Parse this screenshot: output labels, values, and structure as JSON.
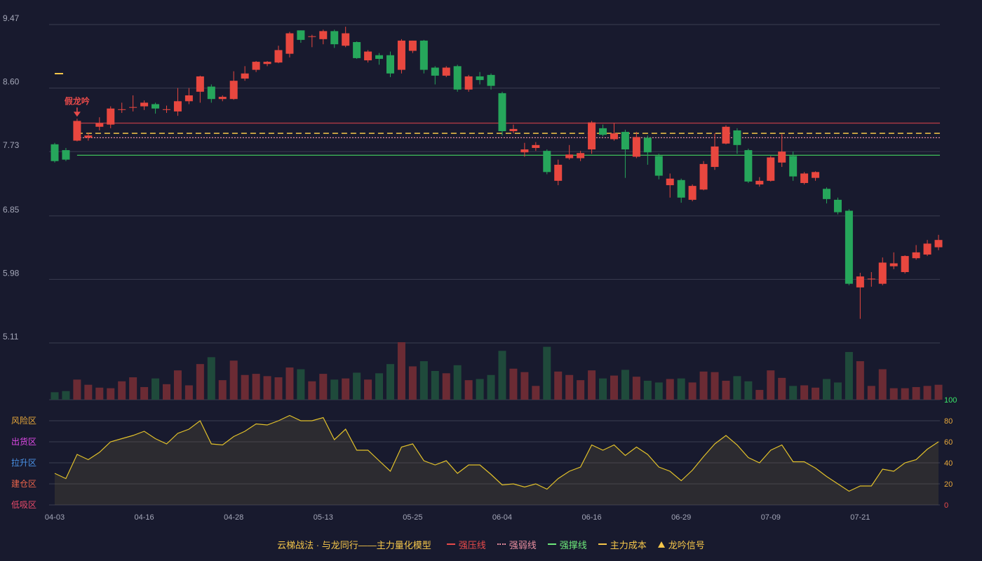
{
  "chart_data": {
    "type": "candlestick",
    "price_ticks": [
      "9.47",
      "8.60",
      "7.73",
      "6.85",
      "5.98",
      "5.11"
    ],
    "ylim": [
      5.11,
      9.47
    ],
    "x_ticks": [
      "04-03",
      "04-16",
      "04-28",
      "05-13",
      "05-25",
      "06-04",
      "06-16",
      "06-29",
      "07-09",
      "07-21"
    ],
    "x_tick_index": [
      0,
      8,
      16,
      24,
      32,
      40,
      48,
      56,
      64,
      72
    ],
    "candles": [
      [
        7.83,
        7.6,
        7.85,
        7.58
      ],
      [
        7.75,
        7.62,
        7.78,
        7.6
      ],
      [
        7.88,
        8.15,
        8.18,
        7.87
      ],
      [
        7.92,
        7.95,
        7.99,
        7.88
      ],
      [
        8.07,
        8.12,
        8.2,
        8.02
      ],
      [
        8.1,
        8.32,
        8.35,
        8.05
      ],
      [
        8.3,
        8.31,
        8.4,
        8.26
      ],
      [
        8.33,
        8.34,
        8.5,
        8.28
      ],
      [
        8.35,
        8.4,
        8.43,
        8.3
      ],
      [
        8.38,
        8.32,
        8.4,
        8.25
      ],
      [
        8.3,
        8.31,
        8.36,
        8.26
      ],
      [
        8.28,
        8.42,
        8.6,
        8.22
      ],
      [
        8.42,
        8.5,
        8.6,
        8.38
      ],
      [
        8.55,
        8.76,
        8.77,
        8.4
      ],
      [
        8.62,
        8.45,
        8.65,
        8.4
      ],
      [
        8.45,
        8.48,
        8.5,
        8.42
      ],
      [
        8.45,
        8.7,
        8.83,
        8.44
      ],
      [
        8.73,
        8.8,
        8.9,
        8.7
      ],
      [
        8.85,
        8.96,
        8.97,
        8.82
      ],
      [
        8.93,
        8.96,
        8.97,
        8.9
      ],
      [
        8.95,
        9.12,
        9.18,
        8.94
      ],
      [
        9.07,
        9.35,
        9.37,
        9.02
      ],
      [
        9.39,
        9.26,
        9.39,
        9.22
      ],
      [
        9.3,
        9.31,
        9.33,
        9.16
      ],
      [
        9.27,
        9.38,
        9.4,
        9.2
      ],
      [
        9.38,
        9.2,
        9.4,
        9.15
      ],
      [
        9.18,
        9.35,
        9.44,
        9.16
      ],
      [
        9.23,
        9.01,
        9.24,
        9.0
      ],
      [
        8.98,
        9.1,
        9.12,
        8.95
      ],
      [
        9.05,
        9.0,
        9.08,
        8.92
      ],
      [
        9.05,
        8.8,
        9.1,
        8.75
      ],
      [
        8.85,
        9.25,
        9.27,
        8.8
      ],
      [
        9.11,
        9.25,
        9.25,
        9.08
      ],
      [
        9.25,
        8.85,
        9.26,
        8.8
      ],
      [
        8.88,
        8.77,
        8.9,
        8.65
      ],
      [
        8.77,
        8.88,
        8.9,
        8.75
      ],
      [
        8.9,
        8.58,
        8.92,
        8.55
      ],
      [
        8.58,
        8.76,
        8.78,
        8.55
      ],
      [
        8.76,
        8.71,
        8.82,
        8.65
      ],
      [
        8.78,
        8.63,
        8.8,
        8.58
      ],
      [
        8.53,
        8.01,
        8.55,
        7.95
      ],
      [
        8.01,
        8.04,
        8.1,
        7.98
      ],
      [
        7.72,
        7.76,
        7.85,
        7.66
      ],
      [
        7.78,
        7.82,
        7.86,
        7.74
      ],
      [
        7.74,
        7.45,
        7.76,
        7.42
      ],
      [
        7.33,
        7.55,
        7.62,
        7.27
      ],
      [
        7.64,
        7.69,
        7.82,
        7.62
      ],
      [
        7.64,
        7.71,
        7.74,
        7.6
      ],
      [
        7.76,
        8.13,
        8.15,
        7.7
      ],
      [
        8.05,
        7.96,
        8.1,
        7.94
      ],
      [
        7.9,
        7.98,
        8.12,
        7.88
      ],
      [
        8.0,
        7.76,
        8.03,
        7.37
      ],
      [
        7.66,
        7.93,
        8.0,
        7.64
      ],
      [
        7.92,
        7.72,
        7.95,
        7.55
      ],
      [
        7.67,
        7.4,
        7.7,
        7.35
      ],
      [
        7.27,
        7.36,
        7.43,
        7.1
      ],
      [
        7.34,
        7.1,
        7.36,
        7.03
      ],
      [
        7.07,
        7.26,
        7.28,
        7.05
      ],
      [
        7.21,
        7.56,
        7.6,
        7.2
      ],
      [
        7.52,
        7.8,
        7.98,
        7.48
      ],
      [
        7.84,
        8.07,
        8.09,
        7.83
      ],
      [
        8.02,
        7.82,
        8.05,
        7.7
      ],
      [
        7.75,
        7.32,
        7.77,
        7.3
      ],
      [
        7.28,
        7.33,
        7.38,
        7.25
      ],
      [
        7.33,
        7.65,
        7.67,
        7.32
      ],
      [
        7.58,
        7.73,
        7.97,
        7.52
      ],
      [
        7.67,
        7.39,
        7.73,
        7.33
      ],
      [
        7.3,
        7.43,
        7.45,
        7.28
      ],
      [
        7.37,
        7.45,
        7.46,
        7.33
      ],
      [
        7.22,
        7.08,
        7.24,
        7.02
      ],
      [
        7.07,
        6.9,
        7.1,
        6.87
      ],
      [
        6.92,
        5.92,
        6.94,
        5.9
      ],
      [
        5.87,
        6.02,
        6.07,
        5.44
      ],
      [
        5.98,
        5.99,
        6.08,
        5.88
      ],
      [
        5.92,
        6.21,
        6.28,
        5.9
      ],
      [
        6.16,
        6.2,
        6.35,
        6.12
      ],
      [
        6.08,
        6.3,
        6.31,
        6.06
      ],
      [
        6.27,
        6.35,
        6.45,
        6.25
      ],
      [
        6.32,
        6.47,
        6.52,
        6.3
      ],
      [
        6.42,
        6.52,
        6.59,
        6.38
      ]
    ],
    "volume_levels": [
      0.13,
      0.15,
      0.35,
      0.26,
      0.21,
      0.2,
      0.32,
      0.39,
      0.22,
      0.37,
      0.27,
      0.51,
      0.25,
      0.62,
      0.74,
      0.34,
      0.68,
      0.43,
      0.45,
      0.41,
      0.39,
      0.56,
      0.53,
      0.32,
      0.45,
      0.35,
      0.37,
      0.47,
      0.35,
      0.46,
      0.62,
      1.0,
      0.58,
      0.67,
      0.5,
      0.46,
      0.6,
      0.34,
      0.36,
      0.43,
      0.85,
      0.54,
      0.48,
      0.24,
      0.92,
      0.49,
      0.43,
      0.34,
      0.51,
      0.37,
      0.42,
      0.52,
      0.4,
      0.33,
      0.3,
      0.36,
      0.37,
      0.3,
      0.49,
      0.48,
      0.33,
      0.41,
      0.32,
      0.17,
      0.51,
      0.38,
      0.24,
      0.25,
      0.21,
      0.36,
      0.3,
      0.83,
      0.67,
      0.24,
      0.53,
      0.2,
      0.2,
      0.22,
      0.24,
      0.26
    ],
    "oscillator": [
      30,
      25,
      48,
      43,
      50,
      60,
      63,
      66,
      70,
      63,
      58,
      68,
      72,
      80,
      58,
      57,
      65,
      70,
      77,
      76,
      80,
      85,
      80,
      80,
      83,
      62,
      72,
      52,
      52,
      42,
      32,
      55,
      58,
      42,
      38,
      42,
      30,
      38,
      38,
      29,
      19,
      20,
      17,
      20,
      15,
      25,
      32,
      36,
      57,
      52,
      57,
      47,
      55,
      48,
      36,
      32,
      23,
      33,
      46,
      58,
      66,
      57,
      45,
      40,
      52,
      57,
      41,
      41,
      35,
      27,
      20,
      13,
      18,
      18,
      34,
      32,
      40,
      43,
      53,
      60
    ],
    "osc_ylim": [
      0,
      100
    ],
    "osc_ticks": [
      "0",
      "20",
      "40",
      "60",
      "80",
      "100"
    ],
    "zones": [
      "低吸区",
      "建仓区",
      "拉升区",
      "出货区",
      "风险区"
    ],
    "h_lines": {
      "strong_pressure": 8.12,
      "main_cost": 7.98,
      "weak": 7.92,
      "support": 7.68
    },
    "signal": {
      "index": 2,
      "label": "假龙吟"
    },
    "legend": {
      "title": "云梯战法 · 与龙同行——主力量化模型",
      "items": [
        {
          "name": "强压线",
          "color": "#e84a4a",
          "style": "solid"
        },
        {
          "name": "强弱线",
          "color": "#ea8fa0",
          "style": "dotted"
        },
        {
          "name": "强撑线",
          "color": "#6de87a",
          "style": "solid"
        },
        {
          "name": "主力成本",
          "color": "#f5c64a",
          "style": "dashed"
        },
        {
          "name": "龙吟信号",
          "color": "#f5c64a",
          "style": "triangle"
        }
      ]
    },
    "colors": {
      "up": "#e8473f",
      "down": "#26a65b",
      "vol_up": "#6b2b34",
      "vol_down": "#1f4a3b",
      "osc_line": "#e2c12a",
      "grid": "#3a3d50",
      "axis_text": "#a4a7b8"
    },
    "zone_colors": [
      "#e84a6a",
      "#e8634a",
      "#4a93e8",
      "#e04ae8",
      "#e8a83a"
    ],
    "osc_tick_colors": [
      "#e84a4a",
      "#e8a83a",
      "#e8a83a",
      "#e8a83a",
      "#e8a83a",
      "#3ae86a"
    ]
  }
}
